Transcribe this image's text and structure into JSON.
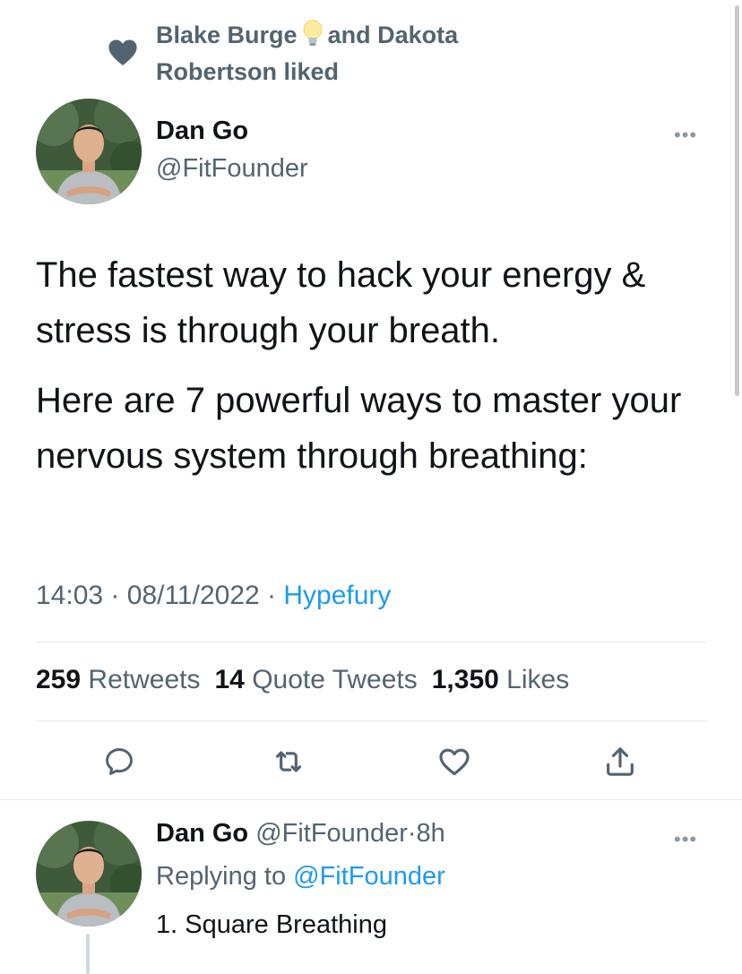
{
  "social_context": {
    "icon": "heart-icon",
    "first_name": "Blake Burge",
    "emoji": "lightbulb-icon",
    "rest": "and Dakota Robertson liked"
  },
  "tweet": {
    "author_name": "Dan Go",
    "author_handle": "@FitFounder",
    "paragraphs": [
      "The fastest way to hack your energy & stress is through your breath.",
      "Here are 7 powerful ways to master your nervous system through breathing:"
    ],
    "time": "14:03",
    "date": "08/11/2022",
    "separator": "·",
    "source": "Hypefury",
    "more_label": "•••"
  },
  "stats": {
    "retweets_count": "259",
    "retweets_label": "Retweets",
    "quotes_count": "14",
    "quotes_label": "Quote Tweets",
    "likes_count": "1,350",
    "likes_label": "Likes"
  },
  "actions": [
    "reply-icon",
    "retweet-icon",
    "like-icon",
    "share-icon"
  ],
  "reply": {
    "author_name": "Dan Go",
    "author_handle": "@FitFounder",
    "separator": "·",
    "age": "8h",
    "replying_prefix": "Replying to",
    "replying_to": "@FitFounder",
    "text": "1. Square Breathing",
    "more_label": "•••"
  },
  "colors": {
    "text_primary": "#0f1419",
    "text_secondary": "#536471",
    "accent": "#1d9bf0",
    "divider": "#e6e9ec"
  }
}
